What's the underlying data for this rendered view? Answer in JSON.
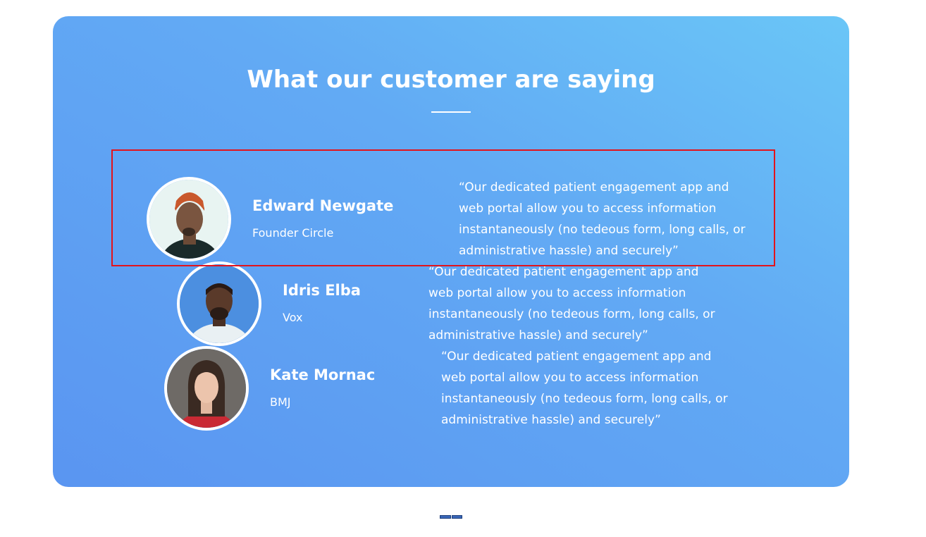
{
  "section": {
    "title": "What our customer are saying"
  },
  "testimonials": [
    {
      "name": "Edward Newgate",
      "company": "Founder Circle",
      "quote": "“Our dedicated patient engagement app and web portal allow you to access information instantaneously (no tedeous form, long calls, or administrative hassle) and securely”"
    },
    {
      "name": "Idris Elba",
      "company": "Vox",
      "quote": "“Our dedicated patient engagement app and web portal allow you to access information instantaneously (no tedeous form, long calls, or administrative hassle) and securely”"
    },
    {
      "name": "Kate Mornac",
      "company": "BMJ",
      "quote": "“Our dedicated patient engagement app and web portal allow you to access information instantaneously (no tedeous form, long calls, or administrative hassle) and securely”"
    }
  ],
  "colors": {
    "card_gradient_start": "#6ac6f7",
    "card_gradient_end": "#5a95f1",
    "highlight_border": "#e3131b",
    "text": "#ffffff"
  }
}
